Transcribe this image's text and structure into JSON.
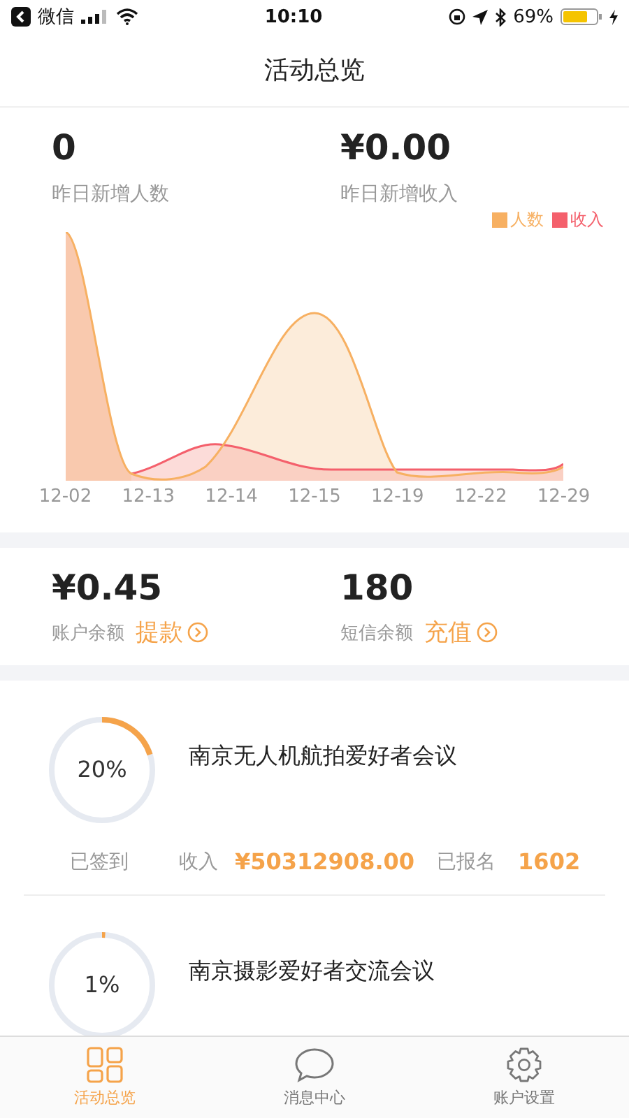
{
  "status_bar": {
    "back_label": "微信",
    "time": "10:10",
    "battery_text": "69%"
  },
  "nav": {
    "title": "活动总览"
  },
  "daily_stats": [
    {
      "value": "0",
      "label": "昨日新增人数"
    },
    {
      "value": "¥0.00",
      "label": "昨日新增收入"
    }
  ],
  "chart": {
    "legend": [
      {
        "label": "人数",
        "color": "#f7b062"
      },
      {
        "label": "收入",
        "color": "#f4606c"
      }
    ],
    "x_labels": [
      "12-02",
      "12-13",
      "12-14",
      "12-15",
      "12-19",
      "12-22",
      "12-29"
    ]
  },
  "balances": [
    {
      "value": "¥0.45",
      "label": "账户余额",
      "action": "提款"
    },
    {
      "value": "180",
      "label": "短信余额",
      "action": "充值"
    }
  ],
  "events": [
    {
      "name": "南京无人机航拍爱好者会议",
      "level": 0.2,
      "percent": "20%",
      "checked_in_label": "已签到",
      "income_label": "收入",
      "income": "¥50312908.00",
      "signed_up_label": "已报名",
      "signed_up": "1602"
    },
    {
      "name": "南京摄影爱好者交流会议",
      "level": 0.01,
      "percent": "1%"
    }
  ],
  "tabs": [
    {
      "label": "活动总览",
      "selected": true,
      "kind": "grid"
    },
    {
      "label": "消息中心",
      "selected": false,
      "kind": "chat"
    },
    {
      "label": "账户设置",
      "selected": false,
      "kind": "gear"
    }
  ]
}
